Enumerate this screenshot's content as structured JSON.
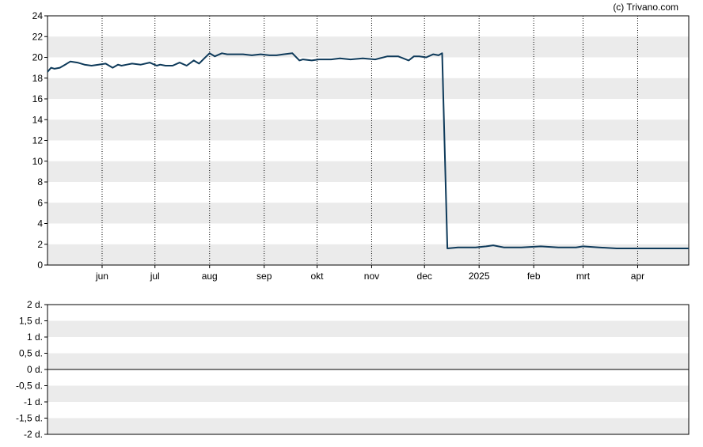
{
  "credit": "(c) Trivano.com",
  "chart_data": [
    {
      "type": "line",
      "x_axis": "date",
      "x_range": [
        "2024-05-01",
        "2025-04-30"
      ],
      "xticks": [
        {
          "label": "jun",
          "date": "2024-06-01"
        },
        {
          "label": "jul",
          "date": "2024-07-01"
        },
        {
          "label": "aug",
          "date": "2024-08-01"
        },
        {
          "label": "sep",
          "date": "2024-09-01"
        },
        {
          "label": "okt",
          "date": "2024-10-01"
        },
        {
          "label": "nov",
          "date": "2024-11-01"
        },
        {
          "label": "dec",
          "date": "2024-12-01"
        },
        {
          "label": "2025",
          "date": "2025-01-01"
        },
        {
          "label": "feb",
          "date": "2025-02-01"
        },
        {
          "label": "mrt",
          "date": "2025-03-01"
        },
        {
          "label": "apr",
          "date": "2025-04-01"
        }
      ],
      "ylim": [
        0,
        24
      ],
      "yticks": [
        "0",
        "2",
        "4",
        "6",
        "8",
        "10",
        "12",
        "14",
        "16",
        "18",
        "20",
        "22",
        "24"
      ],
      "grid": "horizontal bands, dotted vertical lines",
      "colors": {
        "line": "#0e3a5a",
        "band": "#ebebeb"
      },
      "series": [
        {
          "x": [
            "2024-05-01",
            "2024-05-03",
            "2024-05-05",
            "2024-05-08",
            "2024-05-11",
            "2024-05-14",
            "2024-05-18",
            "2024-05-22",
            "2024-05-26",
            "2024-05-30",
            "2024-06-03",
            "2024-06-07",
            "2024-06-10",
            "2024-06-12",
            "2024-06-15",
            "2024-06-18",
            "2024-06-23",
            "2024-06-28",
            "2024-07-02",
            "2024-07-04",
            "2024-07-07",
            "2024-07-11",
            "2024-07-15",
            "2024-07-19",
            "2024-07-23",
            "2024-07-26",
            "2024-07-29",
            "2024-08-01",
            "2024-08-04",
            "2024-08-08",
            "2024-08-11",
            "2024-08-15",
            "2024-08-20",
            "2024-08-25",
            "2024-08-30",
            "2024-09-04",
            "2024-09-08",
            "2024-09-12",
            "2024-09-17",
            "2024-09-21",
            "2024-09-23",
            "2024-09-28",
            "2024-10-02",
            "2024-10-06",
            "2024-10-09",
            "2024-10-14",
            "2024-10-20",
            "2024-10-27",
            "2024-11-03",
            "2024-11-10",
            "2024-11-16",
            "2024-11-22",
            "2024-11-25",
            "2024-11-28",
            "2024-12-02",
            "2024-12-06",
            "2024-12-09",
            "2024-12-11",
            "2024-12-14",
            "2024-12-20",
            "2024-12-30",
            "2025-01-05",
            "2025-01-09",
            "2025-01-15",
            "2025-01-25",
            "2025-02-05",
            "2025-02-15",
            "2025-02-25",
            "2025-03-01",
            "2025-03-10",
            "2025-03-20",
            "2025-04-01",
            "2025-04-10",
            "2025-04-20",
            "2025-04-30"
          ],
          "y": [
            18.6,
            19.0,
            18.9,
            19.0,
            19.3,
            19.6,
            19.5,
            19.3,
            19.2,
            19.3,
            19.4,
            19.0,
            19.3,
            19.2,
            19.3,
            19.4,
            19.3,
            19.5,
            19.2,
            19.3,
            19.2,
            19.2,
            19.5,
            19.2,
            19.7,
            19.4,
            19.9,
            20.4,
            20.1,
            20.4,
            20.3,
            20.3,
            20.3,
            20.2,
            20.3,
            20.2,
            20.2,
            20.3,
            20.4,
            19.7,
            19.8,
            19.7,
            19.8,
            19.8,
            19.8,
            19.9,
            19.8,
            19.9,
            19.8,
            20.1,
            20.1,
            19.7,
            20.1,
            20.1,
            20.0,
            20.3,
            20.2,
            20.4,
            1.6,
            1.7,
            1.7,
            1.8,
            1.9,
            1.7,
            1.7,
            1.8,
            1.7,
            1.7,
            1.8,
            1.7,
            1.6,
            1.6,
            1.6,
            1.6,
            1.6
          ]
        }
      ]
    },
    {
      "type": "line",
      "x_axis": "date",
      "ylim": [
        -2,
        2
      ],
      "yticks": [
        "-2 d.",
        "-1,5 d.",
        "-1 d.",
        "-0,5 d.",
        "0 d.",
        "0,5 d.",
        "1 d.",
        "1,5 d.",
        "2 d."
      ],
      "grid": "horizontal bands",
      "reference_line": 0,
      "series": []
    }
  ]
}
